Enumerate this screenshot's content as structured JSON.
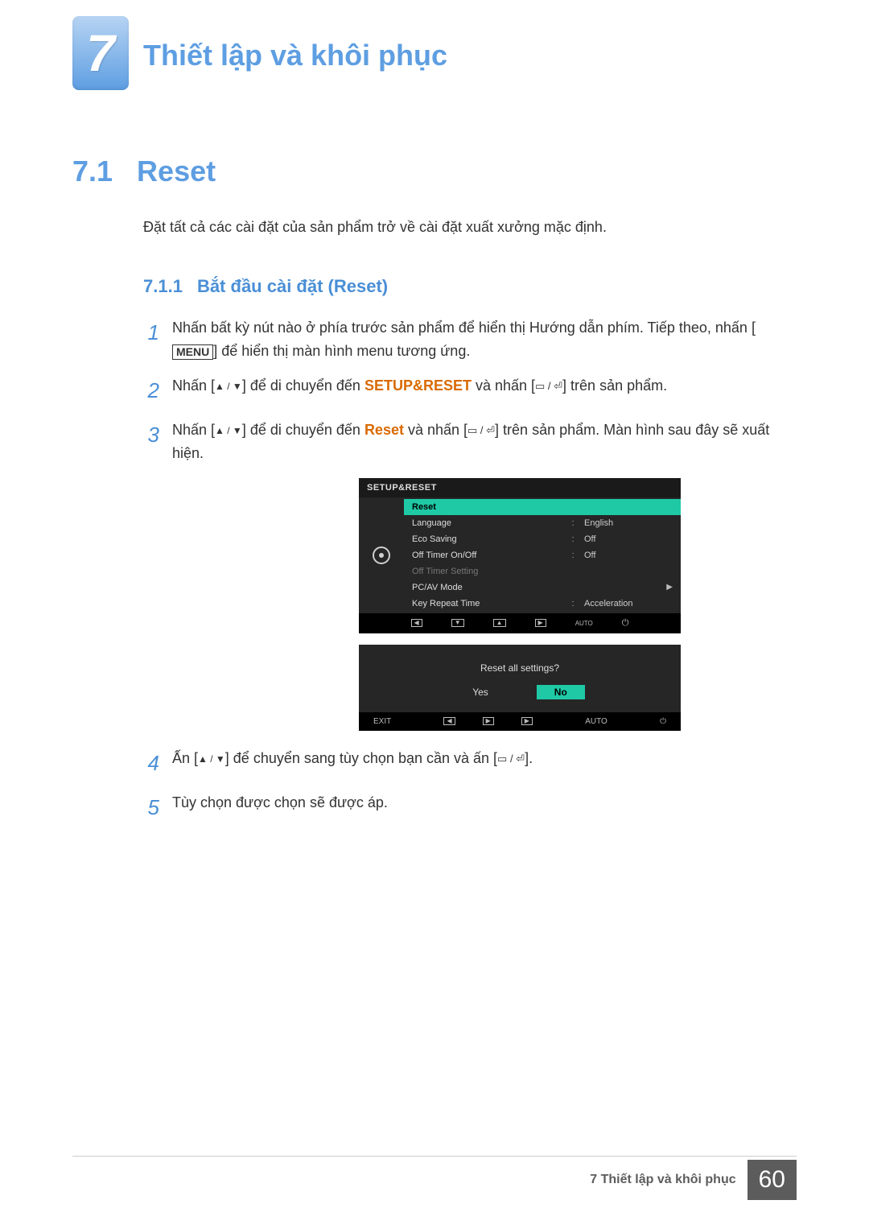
{
  "chapter": {
    "number": "7",
    "title": "Thiết lập và khôi phục"
  },
  "section": {
    "number": "7.1",
    "title": "Reset"
  },
  "intro": "Đặt tất cả các cài đặt của sản phẩm trở về cài đặt xuất xưởng mặc định.",
  "subsection": {
    "number": "7.1.1",
    "title": "Bắt đầu cài đặt (Reset)"
  },
  "steps": {
    "s1a": "Nhấn bất kỳ nút nào ở phía trước sản phẩm để hiển thị Hướng dẫn phím. Tiếp theo, nhấn [",
    "s1b": "] để hiển thị màn hình menu tương ứng.",
    "menu_key": "MENU",
    "s2a": "Nhấn [",
    "s2b": "] để di chuyển đến ",
    "s2c": " và nhấn [",
    "s2d": "] trên sản phẩm.",
    "setupreset": "SETUP&RESET",
    "s3a": "Nhấn [",
    "s3b": "] để di chuyển đến ",
    "s3c": " và nhấn [",
    "s3d": "] trên sản phẩm. Màn hình sau đây sẽ xuất hiện.",
    "reset_word": "Reset",
    "s4a": "Ấn [",
    "s4b": "] để chuyển sang tùy chọn bạn cần và ấn [",
    "s4c": "].",
    "s5": "Tùy chọn được chọn sẽ được áp."
  },
  "osd": {
    "title": "SETUP&RESET",
    "rows": [
      {
        "label": "Reset",
        "value": "",
        "hl": true
      },
      {
        "label": "Language",
        "value": "English"
      },
      {
        "label": "Eco Saving",
        "value": "Off"
      },
      {
        "label": "Off Timer On/Off",
        "value": "Off"
      },
      {
        "label": "Off Timer Setting",
        "value": "",
        "dim": true
      },
      {
        "label": "PC/AV Mode",
        "value": "",
        "chev": true
      },
      {
        "label": "Key Repeat Time",
        "value": "Acceleration"
      }
    ],
    "nav_auto": "AUTO"
  },
  "dialog": {
    "question": "Reset all settings?",
    "yes": "Yes",
    "no": "No",
    "exit": "EXIT",
    "auto": "AUTO"
  },
  "footer": {
    "label": "7 Thiết lập và khôi phục",
    "page": "60"
  }
}
